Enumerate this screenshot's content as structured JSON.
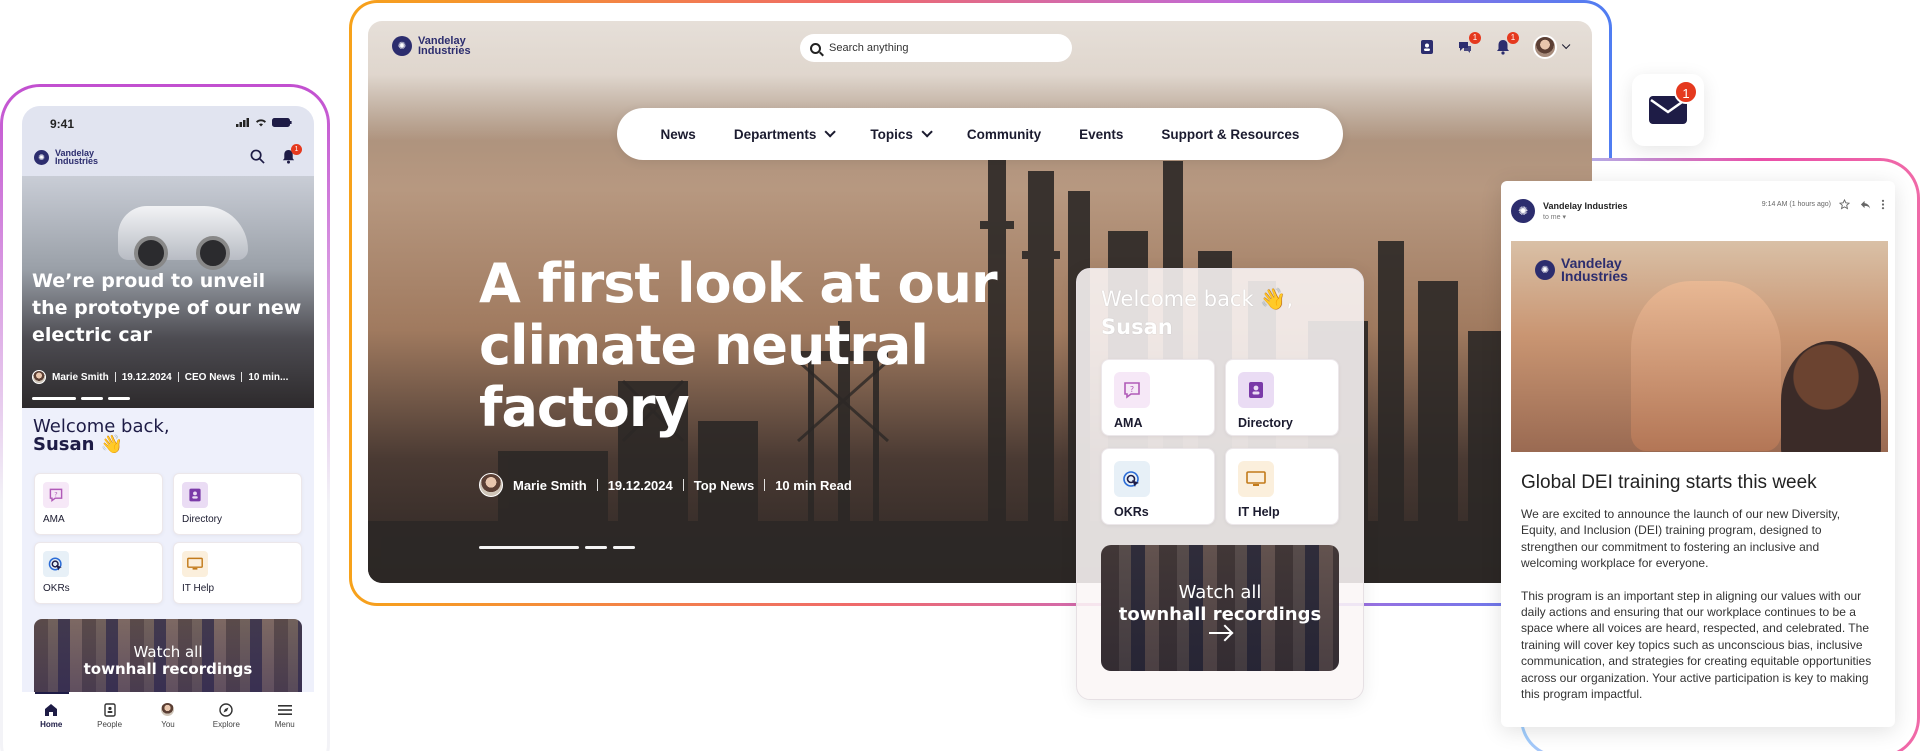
{
  "brand": {
    "name_line1": "Vandelay",
    "name_line2": "Industries"
  },
  "desktop": {
    "search": {
      "placeholder": "Search anything"
    },
    "badges": {
      "chat": "1",
      "bell": "1"
    },
    "nav": [
      "News",
      "Departments",
      "Topics",
      "Community",
      "Events",
      "Support & Resources"
    ],
    "hero": {
      "title": "A first look at our climate neutral factory",
      "author": "Marie Smith",
      "date": "19.12.2024",
      "category": "Top News",
      "read_time": "10 min Read"
    },
    "welcome": {
      "greeting": "Welcome back 👋,",
      "name": "Susan",
      "tiles": [
        "AMA",
        "Directory",
        "OKRs",
        "IT Help"
      ],
      "townhall_line1": "Watch all",
      "townhall_line2": "townhall recordings"
    }
  },
  "phone": {
    "time": "9:41",
    "bell_badge": "1",
    "hero": {
      "title": "We’re proud to unveil the prototype of our new electric car",
      "author": "Marie Smith",
      "date": "19.12.2024",
      "category": "CEO News",
      "read_time": "10 min..."
    },
    "welcome_line1": "Welcome back,",
    "welcome_line2": "Susan 👋",
    "tiles": [
      "AMA",
      "Directory",
      "OKRs",
      "IT Help"
    ],
    "townhall_line1": "Watch all",
    "townhall_line2": "townhall recordings",
    "tabs": [
      "Home",
      "People",
      "You",
      "Explore",
      "Menu"
    ]
  },
  "mail_icon_badge": "1",
  "email": {
    "sender": "Vandelay Industries",
    "to": "to me ▾",
    "time": "9:14 AM (1 hours ago)",
    "title": "Global DEI training starts this week",
    "paragraph1": "We are excited to announce the launch of our new Diversity, Equity, and Inclusion (DEI) training program, designed to strengthen our commitment to fostering an inclusive and welcoming workplace for everyone.",
    "paragraph2": "This program is an important step in aligning our values with our daily actions and ensuring that our workplace continues to be a space where all voices are heard, respected, and celebrated. The training will cover key topics such as unconscious bias, inclusive communication, and strategies for creating equitable opportunities across our organization. Your active participation is key to making this program impactful."
  },
  "colors": {
    "brand_navy": "#2c2d6e",
    "badge_red": "#e5391e",
    "frame_gradient_start": "#f7a21a",
    "frame_gradient_end": "#4f7df2"
  },
  "icons": [
    "search-icon",
    "contacts-icon",
    "chat-icon",
    "bell-icon",
    "chevron-down-icon",
    "question-icon",
    "directory-icon",
    "target-icon",
    "monitor-icon",
    "arrow-right-icon",
    "mail-icon",
    "star-icon",
    "reply-icon",
    "more-icon",
    "home-icon",
    "people-icon",
    "explore-icon",
    "menu-icon"
  ]
}
